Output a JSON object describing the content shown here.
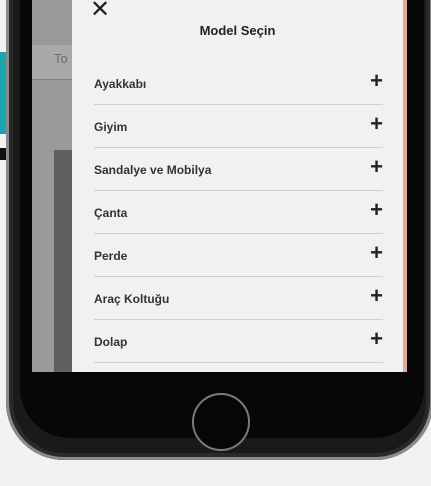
{
  "background": {
    "field_text": "To"
  },
  "modal": {
    "close_icon": "close-icon",
    "close_glyph": "✕",
    "title": "Model Seçin",
    "items": [
      {
        "label": "Ayakkabı",
        "action": "+"
      },
      {
        "label": "Giyim",
        "action": "+"
      },
      {
        "label": "Sandalye ve Mobilya",
        "action": "+"
      },
      {
        "label": "Çanta",
        "action": "+"
      },
      {
        "label": "Perde",
        "action": "+"
      },
      {
        "label": "Araç Koltuğu",
        "action": "+"
      },
      {
        "label": "Dolap",
        "action": "+"
      }
    ]
  },
  "colors": {
    "accent": "#1aa6b0",
    "screen_edge": "#e3a79b"
  }
}
